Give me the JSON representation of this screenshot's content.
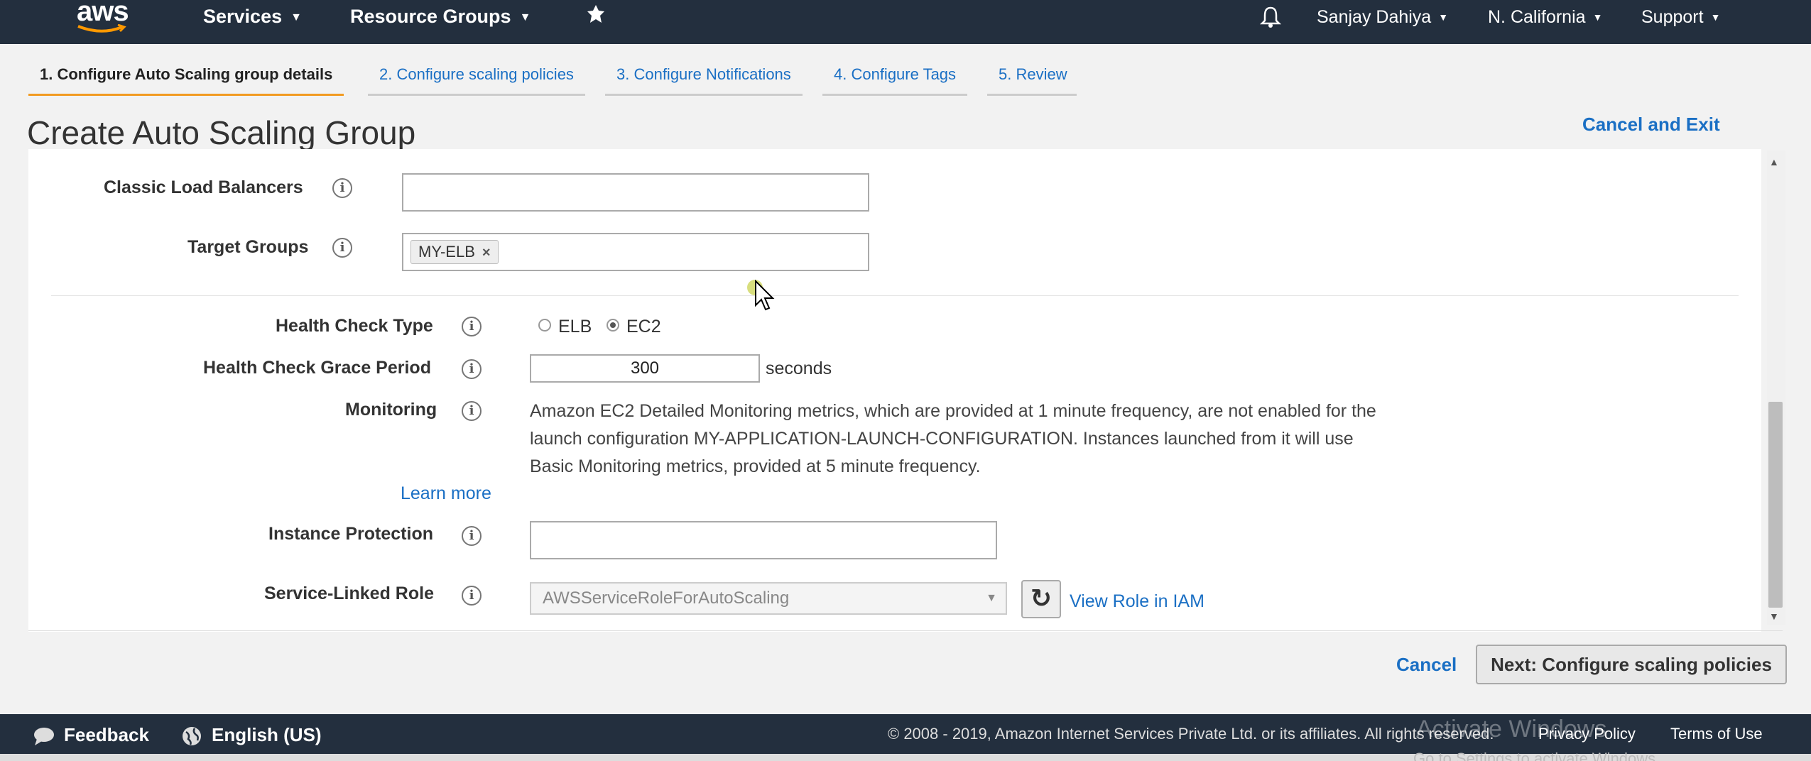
{
  "nav": {
    "logo": "aws",
    "services": "Services",
    "resource_groups": "Resource Groups",
    "pin_icon": "pin-icon",
    "bell_icon": "bell-icon",
    "user": "Sanjay Dahiya",
    "region": "N. California",
    "support": "Support"
  },
  "tabs": [
    {
      "label": "1. Configure Auto Scaling group details",
      "active": true
    },
    {
      "label": "2. Configure scaling policies",
      "active": false
    },
    {
      "label": "3. Configure Notifications",
      "active": false
    },
    {
      "label": "4. Configure Tags",
      "active": false
    },
    {
      "label": "5. Review",
      "active": false
    }
  ],
  "page_title": "Create Auto Scaling Group",
  "cancel_exit": "Cancel and Exit",
  "form": {
    "classic_lb": {
      "label": "Classic Load Balancers",
      "value": ""
    },
    "target_groups": {
      "label": "Target Groups",
      "chip": "MY-ELB",
      "chip_remove": "×"
    },
    "health_check_type": {
      "label": "Health Check Type",
      "options": [
        "ELB",
        "EC2"
      ],
      "selected": "EC2"
    },
    "grace_period": {
      "label": "Health Check Grace Period",
      "value": "300",
      "unit": "seconds"
    },
    "monitoring": {
      "label": "Monitoring",
      "lines": [
        "Amazon EC2 Detailed Monitoring metrics, which are provided at 1 minute frequency, are not enabled for the",
        "launch configuration MY-APPLICATION-LAUNCH-CONFIGURATION. Instances launched from it will use",
        "Basic Monitoring metrics, provided at 5 minute frequency."
      ],
      "learn_more": "Learn more"
    },
    "instance_protection": {
      "label": "Instance Protection",
      "value": ""
    },
    "service_linked_role": {
      "label": "Service-Linked Role",
      "value": "AWSServiceRoleForAutoScaling",
      "view_role": "View Role in IAM"
    }
  },
  "actions": {
    "cancel": "Cancel",
    "next": "Next: Configure scaling policies"
  },
  "footer": {
    "feedback": "Feedback",
    "language": "English (US)",
    "copyright": "© 2008 - 2019, Amazon Internet Services Private Ltd. or its affiliates. All rights reserved.",
    "privacy": "Privacy Policy",
    "terms": "Terms of Use",
    "watermark": "Activate Windows",
    "watermark_sub": "Go to Settings to activate Windows."
  }
}
